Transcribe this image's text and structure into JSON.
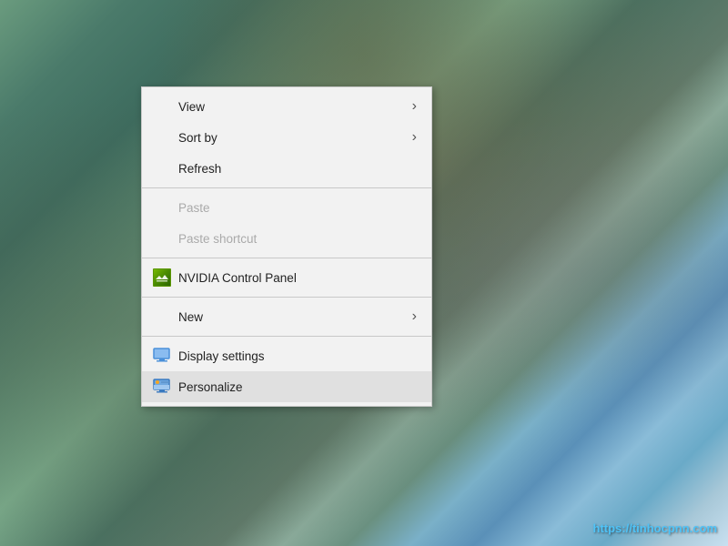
{
  "desktop": {
    "watermark": "https://tinhocpnn.com"
  },
  "contextMenu": {
    "items": [
      {
        "id": "view",
        "label": "View",
        "hasSubmenu": true,
        "disabled": false,
        "icon": null
      },
      {
        "id": "sort-by",
        "label": "Sort by",
        "hasSubmenu": true,
        "disabled": false,
        "icon": null
      },
      {
        "id": "refresh",
        "label": "Refresh",
        "hasSubmenu": false,
        "disabled": false,
        "icon": null
      },
      {
        "id": "divider1",
        "type": "divider"
      },
      {
        "id": "paste",
        "label": "Paste",
        "hasSubmenu": false,
        "disabled": true,
        "icon": null
      },
      {
        "id": "paste-shortcut",
        "label": "Paste shortcut",
        "hasSubmenu": false,
        "disabled": true,
        "icon": null
      },
      {
        "id": "divider2",
        "type": "divider"
      },
      {
        "id": "nvidia",
        "label": "NVIDIA Control Panel",
        "hasSubmenu": false,
        "disabled": false,
        "icon": "nvidia"
      },
      {
        "id": "divider3",
        "type": "divider"
      },
      {
        "id": "new",
        "label": "New",
        "hasSubmenu": true,
        "disabled": false,
        "icon": null
      },
      {
        "id": "divider4",
        "type": "divider"
      },
      {
        "id": "display-settings",
        "label": "Display settings",
        "hasSubmenu": false,
        "disabled": false,
        "icon": "display"
      },
      {
        "id": "personalize",
        "label": "Personalize",
        "hasSubmenu": false,
        "disabled": false,
        "icon": "personalize",
        "highlighted": true
      }
    ]
  }
}
